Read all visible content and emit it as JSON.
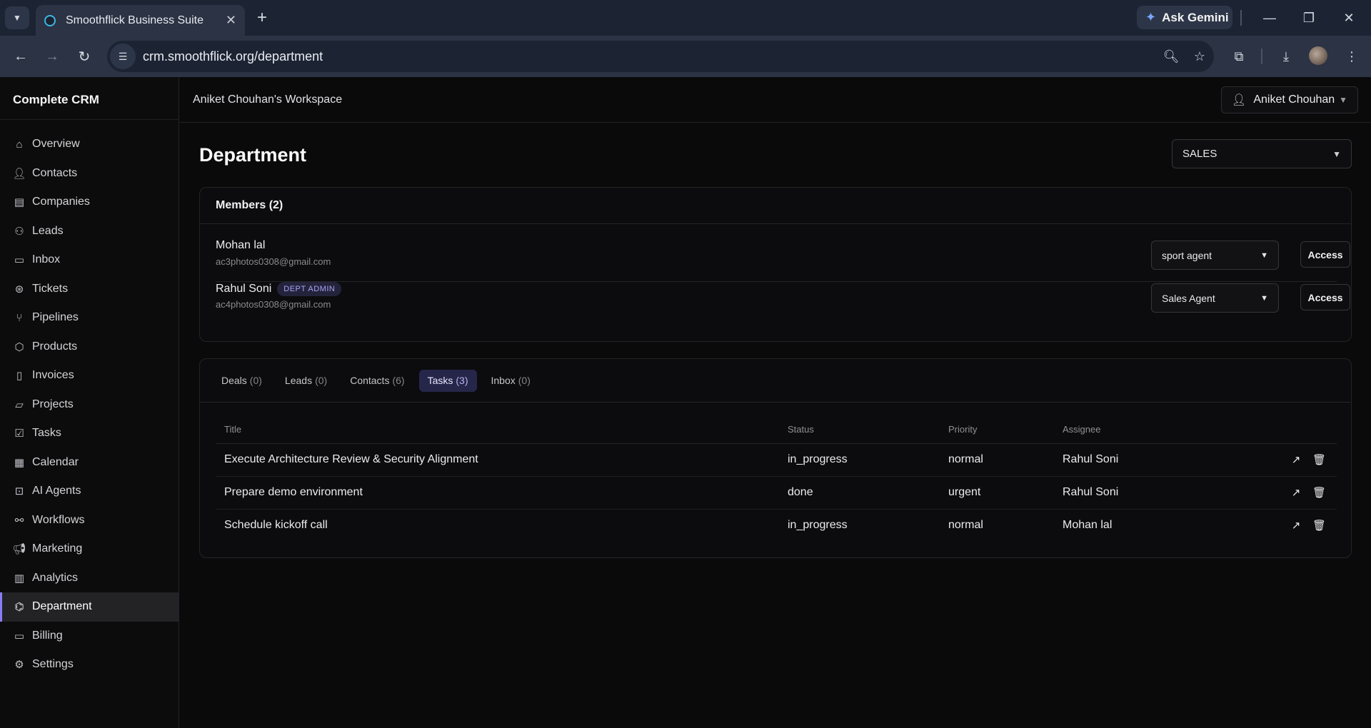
{
  "browser": {
    "tab_title": "Smoothflick Business Suite",
    "url": "crm.smoothflick.org/department",
    "gemini_label": "Ask Gemini"
  },
  "sidebar": {
    "brand": "Complete CRM",
    "items": [
      {
        "label": "Overview",
        "icon": "home-icon"
      },
      {
        "label": "Contacts",
        "icon": "users-icon"
      },
      {
        "label": "Companies",
        "icon": "building-icon"
      },
      {
        "label": "Leads",
        "icon": "user-plus-icon"
      },
      {
        "label": "Inbox",
        "icon": "message-icon"
      },
      {
        "label": "Tickets",
        "icon": "lifebuoy-icon"
      },
      {
        "label": "Pipelines",
        "icon": "branch-icon"
      },
      {
        "label": "Products",
        "icon": "box-icon"
      },
      {
        "label": "Invoices",
        "icon": "document-icon"
      },
      {
        "label": "Projects",
        "icon": "folder-icon"
      },
      {
        "label": "Tasks",
        "icon": "checkbox-icon"
      },
      {
        "label": "Calendar",
        "icon": "calendar-icon"
      },
      {
        "label": "AI Agents",
        "icon": "bot-icon"
      },
      {
        "label": "Workflows",
        "icon": "workflow-icon"
      },
      {
        "label": "Marketing",
        "icon": "megaphone-icon"
      },
      {
        "label": "Analytics",
        "icon": "bar-chart-icon"
      },
      {
        "label": "Department",
        "icon": "network-icon",
        "active": true
      },
      {
        "label": "Billing",
        "icon": "credit-card-icon"
      },
      {
        "label": "Settings",
        "icon": "gear-icon"
      }
    ]
  },
  "header": {
    "workspace": "Aniket Chouhan's Workspace",
    "user_name": "Aniket Chouhan"
  },
  "page": {
    "title": "Department",
    "department_selected": "SALES"
  },
  "members": {
    "heading": "Members (2)",
    "list": [
      {
        "name": "Mohan lal",
        "email": "ac3photos0308@gmail.com",
        "badge": "",
        "role": "sport agent",
        "access_label": "Access"
      },
      {
        "name": "Rahul Soni",
        "email": "ac4photos0308@gmail.com",
        "badge": "DEPT ADMIN",
        "role": "Sales Agent",
        "access_label": "Access"
      }
    ]
  },
  "tabs": [
    {
      "label": "Deals",
      "count": "(0)"
    },
    {
      "label": "Leads",
      "count": "(0)"
    },
    {
      "label": "Contacts",
      "count": "(6)"
    },
    {
      "label": "Tasks",
      "count": "(3)",
      "active": true
    },
    {
      "label": "Inbox",
      "count": "(0)"
    }
  ],
  "tasks": {
    "columns": [
      "Title",
      "Status",
      "Priority",
      "Assignee"
    ],
    "rows": [
      {
        "title": "Execute Architecture Review & Security Alignment",
        "status": "in_progress",
        "priority": "normal",
        "assignee": "Rahul Soni"
      },
      {
        "title": "Prepare demo environment",
        "status": "done",
        "priority": "urgent",
        "assignee": "Rahul Soni"
      },
      {
        "title": "Schedule kickoff call",
        "status": "in_progress",
        "priority": "normal",
        "assignee": "Mohan lal"
      }
    ]
  },
  "colors": {
    "accent": "#8b7cf6",
    "badge_bg": "#24233c",
    "active_tab_bg": "#26264a"
  }
}
